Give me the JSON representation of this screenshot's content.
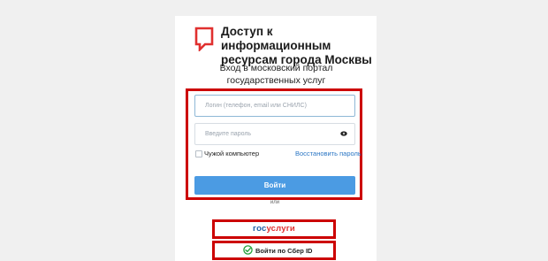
{
  "header": {
    "title_line1": "Доступ к информационным",
    "title_line2": "ресурсам города Москвы",
    "logo_icon": "mos-ru-logo-icon"
  },
  "subtitle": {
    "line1": "Вход в московский портал",
    "line2": "государственных услуг"
  },
  "form": {
    "login_placeholder": "Логин (телефон, email или СНИЛС)",
    "password_placeholder": "Введите пароль",
    "eye_icon": "eye-icon",
    "remember_label": "Чужой компьютер",
    "restore_link": "Восстановить пароль",
    "login_button": "Войти"
  },
  "divider": {
    "or_text": "или"
  },
  "alt_login": {
    "gosuslugi_part1": "гос",
    "gosuslugi_part2": "услуги",
    "sber_label": "Войти по Сбер ID",
    "sber_icon": "sber-check-icon"
  },
  "colors": {
    "accent_blue": "#4b9be3",
    "link_blue": "#2b76c4",
    "logo_red": "#e0302f",
    "highlight_red": "#cc0000"
  }
}
